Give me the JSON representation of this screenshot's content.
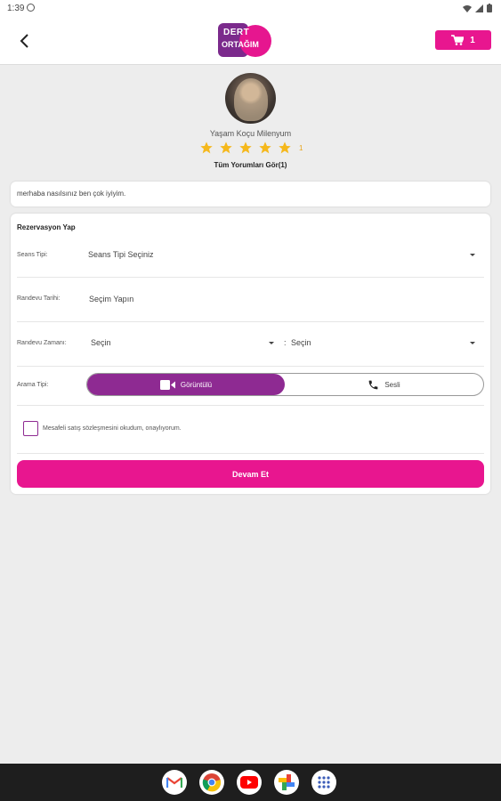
{
  "status_bar": {
    "time": "1:39"
  },
  "header": {
    "logo_line1": "DERT",
    "logo_line2": "ORTAĞIM",
    "cart_count": "1"
  },
  "profile": {
    "name": "Yaşam Koçu Milenyum",
    "rating_count": "1",
    "all_reviews": "Tüm Yorumları Gör(1)"
  },
  "message": "merhaba nasılsınız ben çok iyiyim.",
  "form": {
    "title": "Rezervasyon Yap",
    "session_type_label": "Seans Tipi:",
    "session_type_value": "Seans Tipi Seçiniz",
    "date_label": "Randevu Tarihi:",
    "date_value": "Seçim Yapın",
    "time_label": "Randevu Zamanı:",
    "time_start": "Seçin",
    "time_separator": ":",
    "time_end": "Seçin",
    "call_type_label": "Arama Tipi:",
    "call_video": "Görüntülü",
    "call_voice": "Sesli",
    "agreement": "Mesafeli satış sözleşmesini okudum, onaylıyorum.",
    "continue": "Devam Et"
  },
  "colors": {
    "brand_pink": "#e8168f",
    "brand_purple": "#8e2a92",
    "star": "#f5b81c"
  },
  "dock_icons": [
    "gmail-icon",
    "chrome-icon",
    "youtube-icon",
    "photos-icon",
    "apps-icon"
  ]
}
